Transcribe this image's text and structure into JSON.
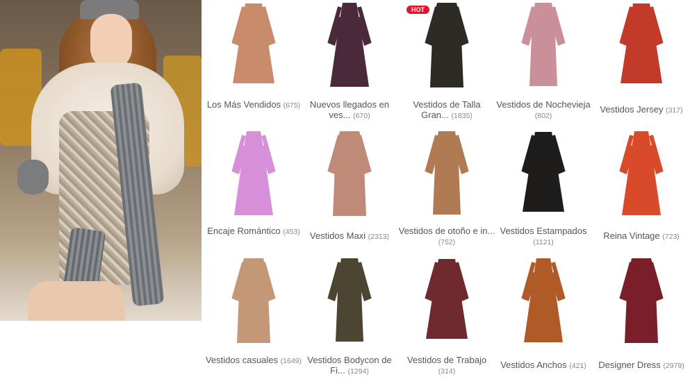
{
  "hero": {
    "alt": "Model in sequin dress and fur vest"
  },
  "badge": {
    "hot": "HOT"
  },
  "categories": [
    {
      "title": "Los Más Vendidos",
      "count": "(675)",
      "color": "#c88c6a"
    },
    {
      "title": "Nuevos llegados en ves...",
      "count": "(670)",
      "color": "#4a2a3a"
    },
    {
      "title": "Vestidos de Talla Gran...",
      "count": "(1835)",
      "color": "#2e2a24"
    },
    {
      "title": "Vestidos de Nochevieja",
      "count": "(802)",
      "color": "#c9909a"
    },
    {
      "title": "Vestidos Jersey",
      "count": "(317)",
      "color": "#c23a2a"
    },
    {
      "title": "Encaje Romántico",
      "count": "(453)",
      "color": "#d68fd8"
    },
    {
      "title": "Vestidos Maxi",
      "count": "(2313)",
      "color": "#c08a78"
    },
    {
      "title": "Vestidos de otoño e in...",
      "count": "(752)",
      "color": "#b07a52"
    },
    {
      "title": "Vestidos Estampados",
      "count": "(1121)",
      "color": "#1f1d1c"
    },
    {
      "title": "Reina Vintage",
      "count": "(723)",
      "color": "#d84a2a"
    },
    {
      "title": "Vestidos casuales",
      "count": "(1649)",
      "color": "#c49877"
    },
    {
      "title": "Vestidos Bodycon de Fi...",
      "count": "(1294)",
      "color": "#4c4532"
    },
    {
      "title": "Vestidos de Trabajo",
      "count": "(314)",
      "color": "#6e2a2c"
    },
    {
      "title": "Vestidos Anchos",
      "count": "(421)",
      "color": "#b05a28"
    },
    {
      "title": "Designer Dress",
      "count": "(2979)",
      "color": "#7a1f2a"
    }
  ]
}
